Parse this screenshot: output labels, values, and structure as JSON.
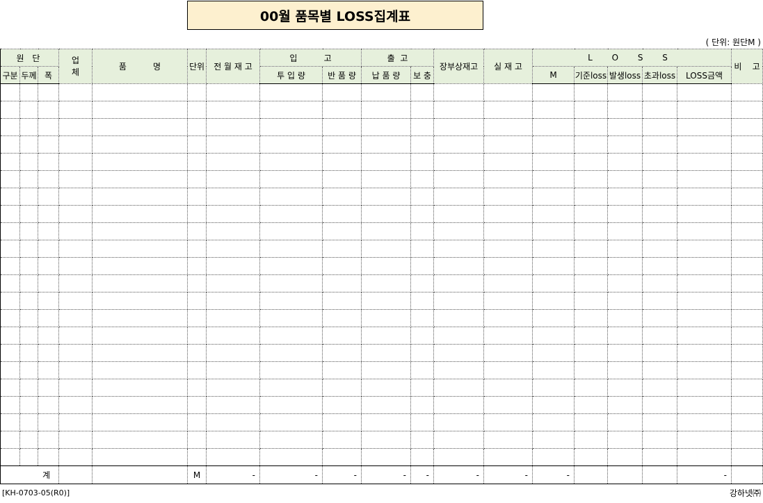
{
  "title": "00월 품목별 LOSS집계표",
  "unit_note": "( 단위: 원단M )",
  "headers": {
    "fabric": "원 단",
    "category": "구분",
    "thickness": "두께",
    "width": "폭",
    "vendor": "업\n체",
    "item_name": "품          명",
    "unit": "단위",
    "prev_stock": "전 월 재 고",
    "inbound": "입          고",
    "inbound_input": "투 입 량",
    "inbound_return": "반 품 량",
    "outbound": "출  고",
    "outbound_delivery": "납 품 량",
    "outbound_supplement": "보 충",
    "book_stock": "장부상재고",
    "actual_stock": "실 재 고",
    "loss": "L O S S",
    "loss_m": "M",
    "loss_standard": "기준loss",
    "loss_occurred": "발생loss",
    "loss_excess": "초과loss",
    "loss_amount": "LOSS금액",
    "remarks": "비    고"
  },
  "body_row_count": 22,
  "total_row": {
    "label": "계",
    "unit": "M",
    "prev_stock": "-",
    "inbound_input": "-",
    "inbound_return": "-",
    "outbound_delivery": "-",
    "outbound_supplement": "-",
    "book_stock": "-",
    "actual_stock": "-",
    "loss_m": "-",
    "loss_amount": "-"
  },
  "footer": {
    "doc_code": "[KH-0703-05(R0)]",
    "company": "강하넷㈜"
  }
}
